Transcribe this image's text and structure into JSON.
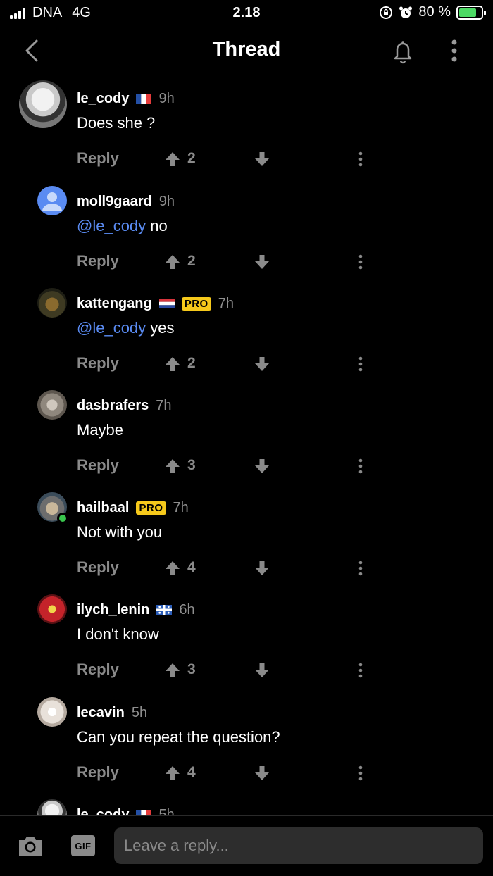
{
  "status": {
    "carrier": "DNA",
    "network": "4G",
    "time": "2.18",
    "battery": "80 %",
    "battery_level": 0.8
  },
  "header": {
    "title": "Thread"
  },
  "comments": [
    {
      "user": "le_cody",
      "flag": "france",
      "pro": false,
      "age": "9h",
      "mention": "",
      "text": "Does she ?",
      "reply": "Reply",
      "votes": "2",
      "avatar": "user-photo"
    },
    {
      "user": "moll9gaard",
      "flag": "",
      "pro": false,
      "age": "9h",
      "mention": "@le_cody",
      "text": " no",
      "reply": "Reply",
      "votes": "2",
      "avatar": "default-user"
    },
    {
      "user": "kattengang",
      "flag": "netherlands",
      "pro": true,
      "pro_label": "PRO",
      "age": "7h",
      "mention": "@le_cody",
      "text": " yes",
      "reply": "Reply",
      "votes": "2",
      "avatar": "user-photo"
    },
    {
      "user": "dasbrafers",
      "flag": "",
      "pro": false,
      "age": "7h",
      "mention": "",
      "text": "Maybe",
      "reply": "Reply",
      "votes": "3",
      "avatar": "user-photo"
    },
    {
      "user": "hailbaal",
      "flag": "",
      "pro": true,
      "pro_label": "PRO",
      "age": "7h",
      "mention": "",
      "text": "Not with you",
      "reply": "Reply",
      "votes": "4",
      "avatar": "user-photo",
      "online": true
    },
    {
      "user": "ilych_lenin",
      "flag": "quebec",
      "pro": false,
      "age": "6h",
      "mention": "",
      "text": "I don't know",
      "reply": "Reply",
      "votes": "3",
      "avatar": "user-photo"
    },
    {
      "user": "lecavin",
      "flag": "",
      "pro": false,
      "age": "5h",
      "mention": "",
      "text": "Can you repeat the question?",
      "reply": "Reply",
      "votes": "4",
      "avatar": "user-photo"
    },
    {
      "user": "le_cody",
      "flag": "france",
      "pro": false,
      "age": "5h",
      "mention": "",
      "text": "",
      "reply": "",
      "votes": "",
      "avatar": "user-photo"
    }
  ],
  "composer": {
    "gif_label": "GIF",
    "placeholder": "Leave a reply..."
  },
  "colors": {
    "mention": "#5a8bf2",
    "pro_badge": "#f6c91b",
    "muted": "#8a8a8a",
    "online": "#39c54d"
  }
}
